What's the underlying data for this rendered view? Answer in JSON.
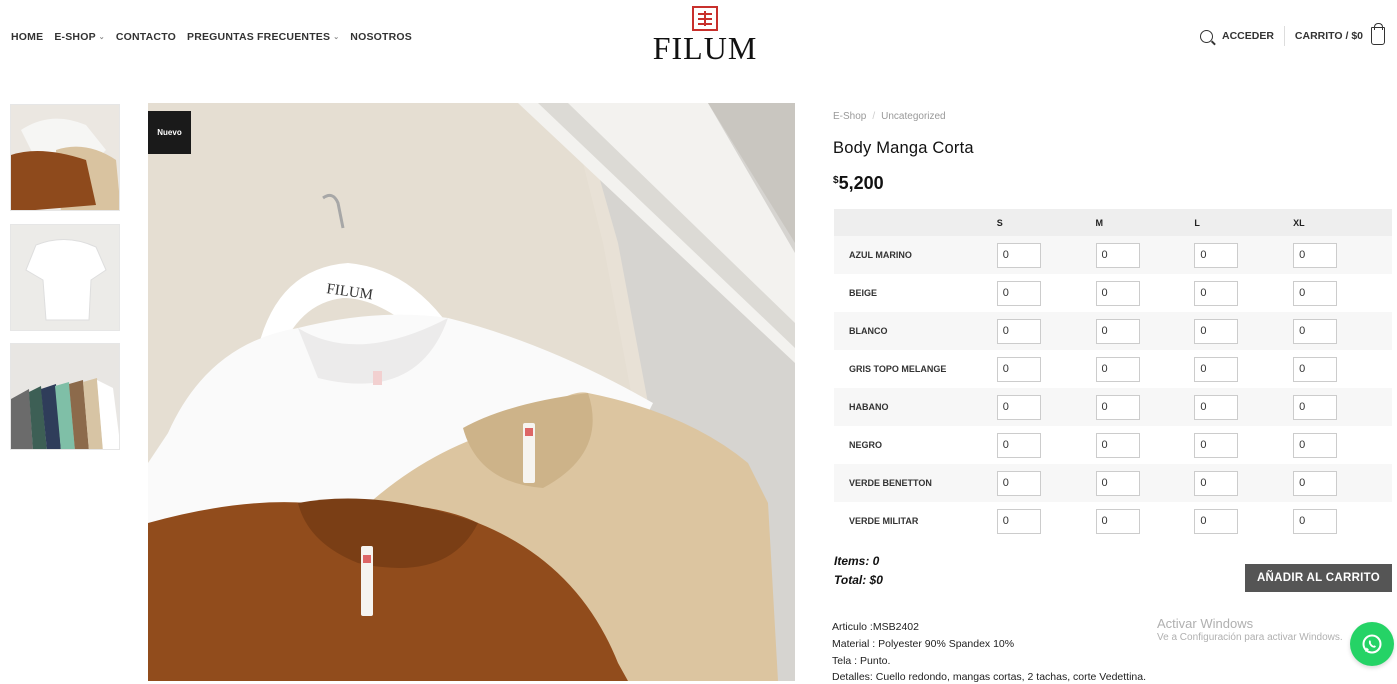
{
  "nav": {
    "items": [
      {
        "label": "HOME",
        "has_dropdown": false
      },
      {
        "label": "E-SHOP",
        "has_dropdown": true
      },
      {
        "label": "CONTACTO",
        "has_dropdown": false
      },
      {
        "label": "PREGUNTAS FRECUENTES",
        "has_dropdown": true
      },
      {
        "label": "NOSOTROS",
        "has_dropdown": false
      }
    ]
  },
  "logo": {
    "text": "FILUM"
  },
  "header_right": {
    "login_label": "ACCEDER",
    "cart_label": "CARRITO / $0"
  },
  "product": {
    "badge": "Nuevo",
    "breadcrumb": [
      "E-Shop",
      "Uncategorized"
    ],
    "title": "Body Manga Corta",
    "price_symbol": "$",
    "price_value": "5,200"
  },
  "variation_grid": {
    "sizes": [
      "S",
      "M",
      "L",
      "XL"
    ],
    "colors": [
      "AZUL MARINO",
      "BEIGE",
      "BLANCO",
      "GRIS TOPO MELANGE",
      "HABANO",
      "NEGRO",
      "VERDE BENETTON",
      "VERDE MILITAR"
    ],
    "default_qty": "0"
  },
  "summary": {
    "items_label": "Items: 0",
    "total_label": "Total: $0",
    "add_button": "AÑADIR AL CARRITO"
  },
  "details": [
    "Articulo :MSB2402",
    "Material : Polyester 90% Spandex 10%",
    "Tela : Punto.",
    "Detalles:  Cuello redondo, mangas cortas, 2 tachas, corte Vedettina."
  ],
  "watermark": {
    "line1": "Activar Windows",
    "line2": "Ve a Configuración para activar Windows."
  },
  "image_text": {
    "hanger": "FILUM"
  },
  "colors": {
    "accent_red": "#c8302c",
    "button_gray": "#555555",
    "whatsapp_green": "#25d366"
  }
}
